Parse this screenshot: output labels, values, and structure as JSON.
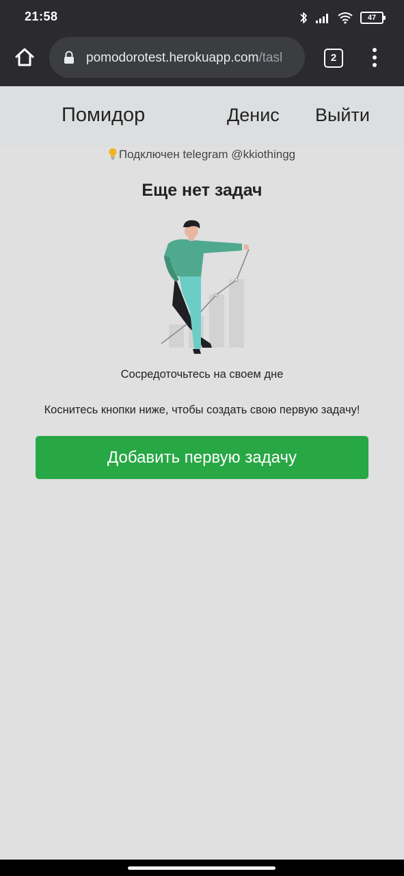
{
  "status_bar": {
    "time": "21:58",
    "battery": "47",
    "icons": [
      "bluetooth-icon",
      "signal-icon",
      "wifi-icon",
      "battery-icon"
    ]
  },
  "browser": {
    "url_host": "pomodorotest.herokuapp.com",
    "url_path": "/tasl",
    "tab_count": "2"
  },
  "header": {
    "brand": "Помидор",
    "user_name": "Денис",
    "logout": "Выйти"
  },
  "main": {
    "telegram_status": "Подключен telegram @kkiothingg",
    "empty_title": "Еще нет задач",
    "focus_text": "Сосредоточьтесь на своем дне",
    "hint_text": "Коснитесь кнопки ниже, чтобы создать свою первую задачу!",
    "add_button": "Добавить первую задачу"
  },
  "colors": {
    "accent_green": "#28a745",
    "background": "#e0e0e0",
    "header_bg": "#dcdee0",
    "system_bar": "#2b2b2f"
  }
}
